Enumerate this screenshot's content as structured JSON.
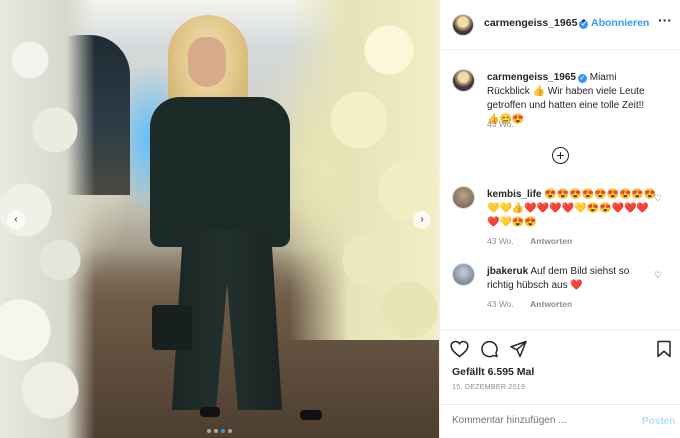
{
  "post": {
    "username": "carmengeiss_1965",
    "follow_label": "Abonnieren",
    "more_label": "···",
    "dot_separator": "•",
    "verified_mark": "✓"
  },
  "caption": {
    "username": "carmengeiss_1965",
    "text": "Miami Rückblick 👍 Wir haben viele Leute getroffen und hatten eine tolle Zeit!! 👍😊😍",
    "time": "43 Wo."
  },
  "load_more_label": "+",
  "comments": [
    {
      "username": "kembis_life",
      "text": "😍😍😍😍😍😍😍😍😍💛💛👍❤️❤️❤️❤️💛😍😍❤️❤️❤️❤️💛😍😍",
      "time": "43 Wo.",
      "reply_label": "Antworten"
    },
    {
      "username": "jbakeruk",
      "text": "Auf dem Bild siehst so richtig hübsch aus ❤️",
      "time": "43 Wo.",
      "reply_label": "Antworten"
    }
  ],
  "likes_text": "Gefällt 6.595 Mal",
  "date_text": "15. DEZEMBER 2019",
  "comment_input": {
    "placeholder": "Kommentar hinzufügen ...",
    "post_label": "Posten"
  },
  "carousel": {
    "prev_label": "‹",
    "next_label": "›",
    "slide_count": 4,
    "active_slide": 2
  },
  "colors": {
    "accent": "#3897f0",
    "post_disabled": "#b2dffc",
    "meta_gray": "#8e8e8e"
  },
  "icons": [
    "heart-icon",
    "comment-icon",
    "share-icon",
    "bookmark-icon",
    "plus-circle-icon",
    "verified-icon",
    "more-icon"
  ]
}
